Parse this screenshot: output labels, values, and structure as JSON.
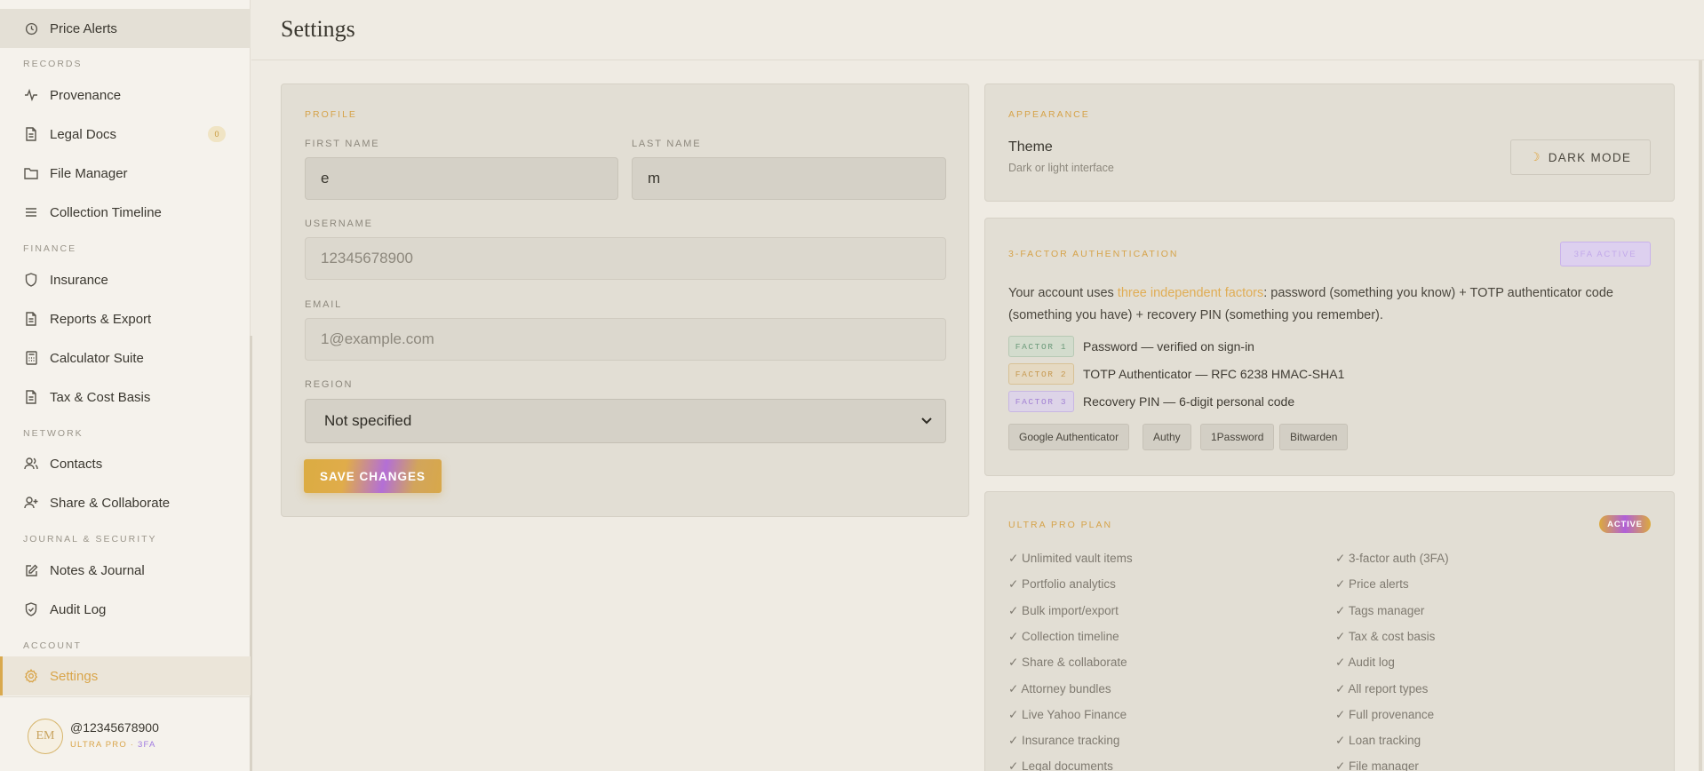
{
  "app": {
    "page_title": "Settings"
  },
  "sidebar": {
    "top_item": {
      "label": "Price Alerts",
      "icon": "clock-icon"
    },
    "sections": [
      {
        "label": "RECORDS"
      },
      {
        "label": "FINANCE"
      },
      {
        "label": "NETWORK"
      },
      {
        "label": "JOURNAL & SECURITY"
      },
      {
        "label": "ACCOUNT"
      }
    ],
    "items": [
      {
        "label": "Provenance",
        "icon": "activity-icon"
      },
      {
        "label": "Legal Docs",
        "icon": "document-icon",
        "badge": "0"
      },
      {
        "label": "File Manager",
        "icon": "folder-icon"
      },
      {
        "label": "Collection Timeline",
        "icon": "list-icon"
      },
      {
        "label": "Insurance",
        "icon": "shield-icon"
      },
      {
        "label": "Reports & Export",
        "icon": "document-icon"
      },
      {
        "label": "Calculator Suite",
        "icon": "calculator-icon"
      },
      {
        "label": "Tax & Cost Basis",
        "icon": "document-icon"
      },
      {
        "label": "Contacts",
        "icon": "users-icon"
      },
      {
        "label": "Share & Collaborate",
        "icon": "user-plus-icon"
      },
      {
        "label": "Notes & Journal",
        "icon": "edit-icon"
      },
      {
        "label": "Audit Log",
        "icon": "shield-check-icon"
      },
      {
        "label": "Settings",
        "icon": "gear-icon"
      }
    ],
    "user": {
      "initials": "EM",
      "handle": "@12345678900",
      "plan": "ULTRA PRO · ",
      "plan_fa": "3FA"
    }
  },
  "profile": {
    "section_label": "PROFILE",
    "first_name_label": "FIRST NAME",
    "first_name_value": "e",
    "last_name_label": "LAST NAME",
    "last_name_value": "m",
    "username_label": "USERNAME",
    "username_value": "12345678900",
    "email_label": "EMAIL",
    "email_value": "1@example.com",
    "region_label": "REGION",
    "region_value": "Not specified",
    "save_label": "SAVE CHANGES"
  },
  "appearance": {
    "section_label": "APPEARANCE",
    "theme_title": "Theme",
    "theme_sub": "Dark or light interface",
    "dark_mode_label": "DARK MODE",
    "dark_mode_icon": "moon-icon"
  },
  "auth": {
    "section_label": "3-FACTOR AUTHENTICATION",
    "pill": "3FA ACTIVE",
    "desc_pre": "Your account uses ",
    "desc_hl": "three independent factors",
    "desc_post": ": password (something you know) + TOTP authenticator code (something you have) + recovery PIN (something you remember).",
    "factors": [
      {
        "tag": "FACTOR 1",
        "text": "Password — verified on sign-in"
      },
      {
        "tag": "FACTOR 2",
        "text": "TOTP Authenticator — RFC 6238 HMAC-SHA1"
      },
      {
        "tag": "FACTOR 3",
        "text": "Recovery PIN — 6-digit personal code"
      }
    ],
    "apps": [
      "Google Authenticator",
      "Authy",
      "1Password",
      "Bitwarden"
    ]
  },
  "plan": {
    "section_label": "ULTRA PRO PLAN",
    "status": "ACTIVE",
    "features_left": [
      "✓ Unlimited vault items",
      "✓ Portfolio analytics",
      "✓ Bulk import/export",
      "✓ Collection timeline",
      "✓ Share & collaborate",
      "✓ Attorney bundles",
      "✓ Live Yahoo Finance",
      "✓ Insurance tracking",
      "✓ Legal documents"
    ],
    "features_right": [
      "✓ 3-factor auth (3FA)",
      "✓ Price alerts",
      "✓ Tags manager",
      "✓ Tax & cost basis",
      "✓ Audit log",
      "✓ All report types",
      "✓ Full provenance",
      "✓ Loan tracking",
      "✓ File manager"
    ]
  },
  "colors": {
    "accent": "#d9a54a",
    "purple": "#a07be0",
    "background": "#efebe3"
  }
}
